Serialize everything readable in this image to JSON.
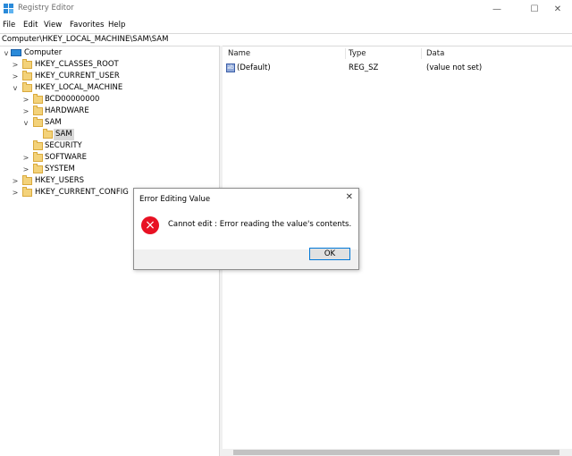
{
  "window": {
    "title": "Registry Editor",
    "minimize": "—",
    "maximize": "☐",
    "close": "✕"
  },
  "menu": [
    "File",
    "Edit",
    "View",
    "Favorites",
    "Help"
  ],
  "address": "Computer\\HKEY_LOCAL_MACHINE\\SAM\\SAM",
  "tree": [
    {
      "label": "Computer",
      "chev": "v",
      "kind": "computer"
    },
    {
      "label": "HKEY_CLASSES_ROOT",
      "chev": ">",
      "kind": "folder"
    },
    {
      "label": "HKEY_CURRENT_USER",
      "chev": ">",
      "kind": "folder"
    },
    {
      "label": "HKEY_LOCAL_MACHINE",
      "chev": "v",
      "kind": "folder"
    },
    {
      "label": "BCD00000000",
      "chev": ">",
      "kind": "folder"
    },
    {
      "label": "HARDWARE",
      "chev": ">",
      "kind": "folder"
    },
    {
      "label": "SAM",
      "chev": "v",
      "kind": "folder"
    },
    {
      "label": "SAM",
      "chev": "",
      "kind": "folder",
      "selected": true
    },
    {
      "label": "SECURITY",
      "chev": "",
      "kind": "folder"
    },
    {
      "label": "SOFTWARE",
      "chev": ">",
      "kind": "folder"
    },
    {
      "label": "SYSTEM",
      "chev": ">",
      "kind": "folder"
    },
    {
      "label": "HKEY_USERS",
      "chev": ">",
      "kind": "folder"
    },
    {
      "label": "HKEY_CURRENT_CONFIG",
      "chev": ">",
      "kind": "folder"
    }
  ],
  "list": {
    "headers": {
      "name": "Name",
      "type": "Type",
      "data": "Data"
    },
    "rows": [
      {
        "icon": "ab",
        "name": "(Default)",
        "type": "REG_SZ",
        "data": "(value not set)"
      }
    ]
  },
  "dialog": {
    "title": "Error Editing Value",
    "close": "✕",
    "icon": "×",
    "message": "Cannot edit :  Error reading the value's contents.",
    "ok": "OK"
  },
  "colors": {
    "error": "#e81123",
    "folder": "#f3d27a",
    "accent": "#0078d7"
  }
}
